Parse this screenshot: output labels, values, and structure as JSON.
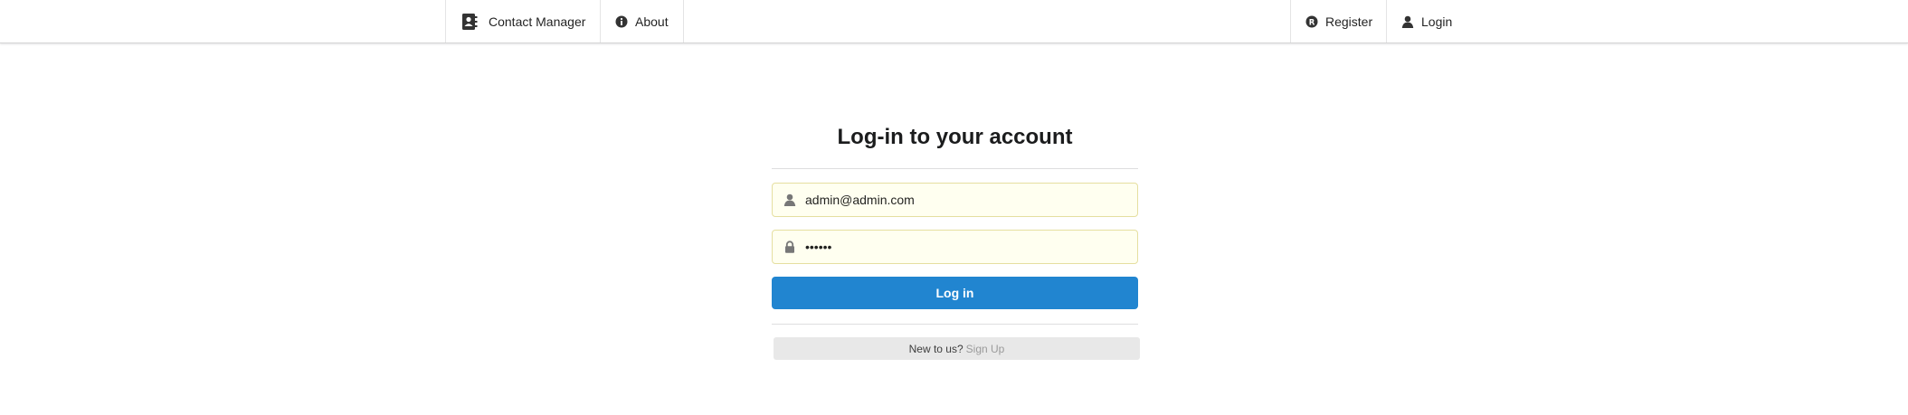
{
  "nav": {
    "contact_manager": "Contact Manager",
    "about": "About",
    "register": "Register",
    "login": "Login"
  },
  "icons": {
    "contact_manager": "address-book-icon",
    "about": "info-circle-icon",
    "register": "registered-icon",
    "login": "user-icon",
    "email": "user-icon",
    "password": "lock-icon"
  },
  "form": {
    "title": "Log-in to your account",
    "email_value": "admin@admin.com",
    "password_value": "••••••",
    "login_label": "Log in"
  },
  "footer": {
    "new_to_us": "New to us?",
    "sign_up": "Sign Up"
  },
  "colors": {
    "primary": "#2185d0",
    "field_bg": "#fffff0",
    "field_border": "#e5dfa0",
    "message_bg": "#e8e8e8"
  }
}
